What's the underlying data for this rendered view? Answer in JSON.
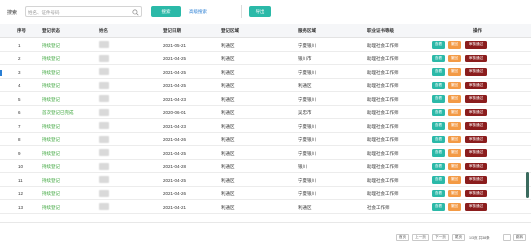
{
  "toolbar": {
    "search_label": "搜索",
    "search_placeholder": "姓名、证件号码",
    "search_button": "搜索",
    "advanced_link": "高级搜索",
    "export_button": "导出"
  },
  "table": {
    "headers": [
      "序号",
      "登记状态",
      "姓名",
      "登记日期",
      "登记区域",
      "服务区域",
      "职业证书等级",
      "操作"
    ],
    "rows": [
      {
        "idx": "1",
        "status": "持续登记",
        "date": "2021-05-21",
        "region": "利通区",
        "area": "宁夏银川",
        "level": "助理社会工作师"
      },
      {
        "idx": "2",
        "status": "持续登记",
        "date": "2021-04-25",
        "region": "利通区",
        "area": "银川市",
        "level": "助理社会工作师"
      },
      {
        "idx": "3",
        "status": "持续登记",
        "date": "2021-04-25",
        "region": "利通区",
        "area": "宁夏银川",
        "level": "助理社会工作师"
      },
      {
        "idx": "4",
        "status": "持续登记",
        "date": "2021-04-25",
        "region": "利通区",
        "area": "利通区",
        "level": "助理社会工作师"
      },
      {
        "idx": "5",
        "status": "持续登记",
        "date": "2021-04-23",
        "region": "利通区",
        "area": "宁夏银川",
        "level": "助理社会工作师"
      },
      {
        "idx": "6",
        "status": "首次登记已完成",
        "date": "2020-06-01",
        "region": "利通区",
        "area": "吴忠市",
        "level": "助理社会工作师"
      },
      {
        "idx": "7",
        "status": "持续登记",
        "date": "2021-04-23",
        "region": "利通区",
        "area": "宁夏银川",
        "level": "助理社会工作师"
      },
      {
        "idx": "8",
        "status": "持续登记",
        "date": "2021-04-26",
        "region": "利通区",
        "area": "宁夏银川",
        "level": "助理社会工作师"
      },
      {
        "idx": "9",
        "status": "持续登记",
        "date": "2021-04-25",
        "region": "利通区",
        "area": "宁夏银川",
        "level": "助理社会工作师"
      },
      {
        "idx": "10",
        "status": "持续登记",
        "date": "2021-04-28",
        "region": "利通区",
        "area": "银川",
        "level": "助理社会工作师"
      },
      {
        "idx": "11",
        "status": "持续登记",
        "date": "2021-04-25",
        "region": "利通区",
        "area": "宁夏银川",
        "level": "助理社会工作师"
      },
      {
        "idx": "12",
        "status": "持续登记",
        "date": "2021-04-26",
        "region": "利通区",
        "area": "宁夏银川",
        "level": "助理社会工作师"
      },
      {
        "idx": "13",
        "status": "持续登记",
        "date": "2021-04-21",
        "region": "利通区",
        "area": "利通区",
        "level": "社会工作师"
      }
    ],
    "actions": {
      "view": "查看",
      "revoke": "撤回",
      "cert": "审核通过"
    }
  },
  "pager": {
    "first": "首页",
    "prev": "上一页",
    "next": "下一页",
    "last": "尾页",
    "info": "1/3页 共38条",
    "goto": "跳转"
  },
  "colors": {
    "accent": "#2bb9a8",
    "revoke": "#f39a45",
    "cert": "#8b1d1d",
    "status_green": "#3aa53a",
    "link_blue": "#2a7fd4"
  }
}
